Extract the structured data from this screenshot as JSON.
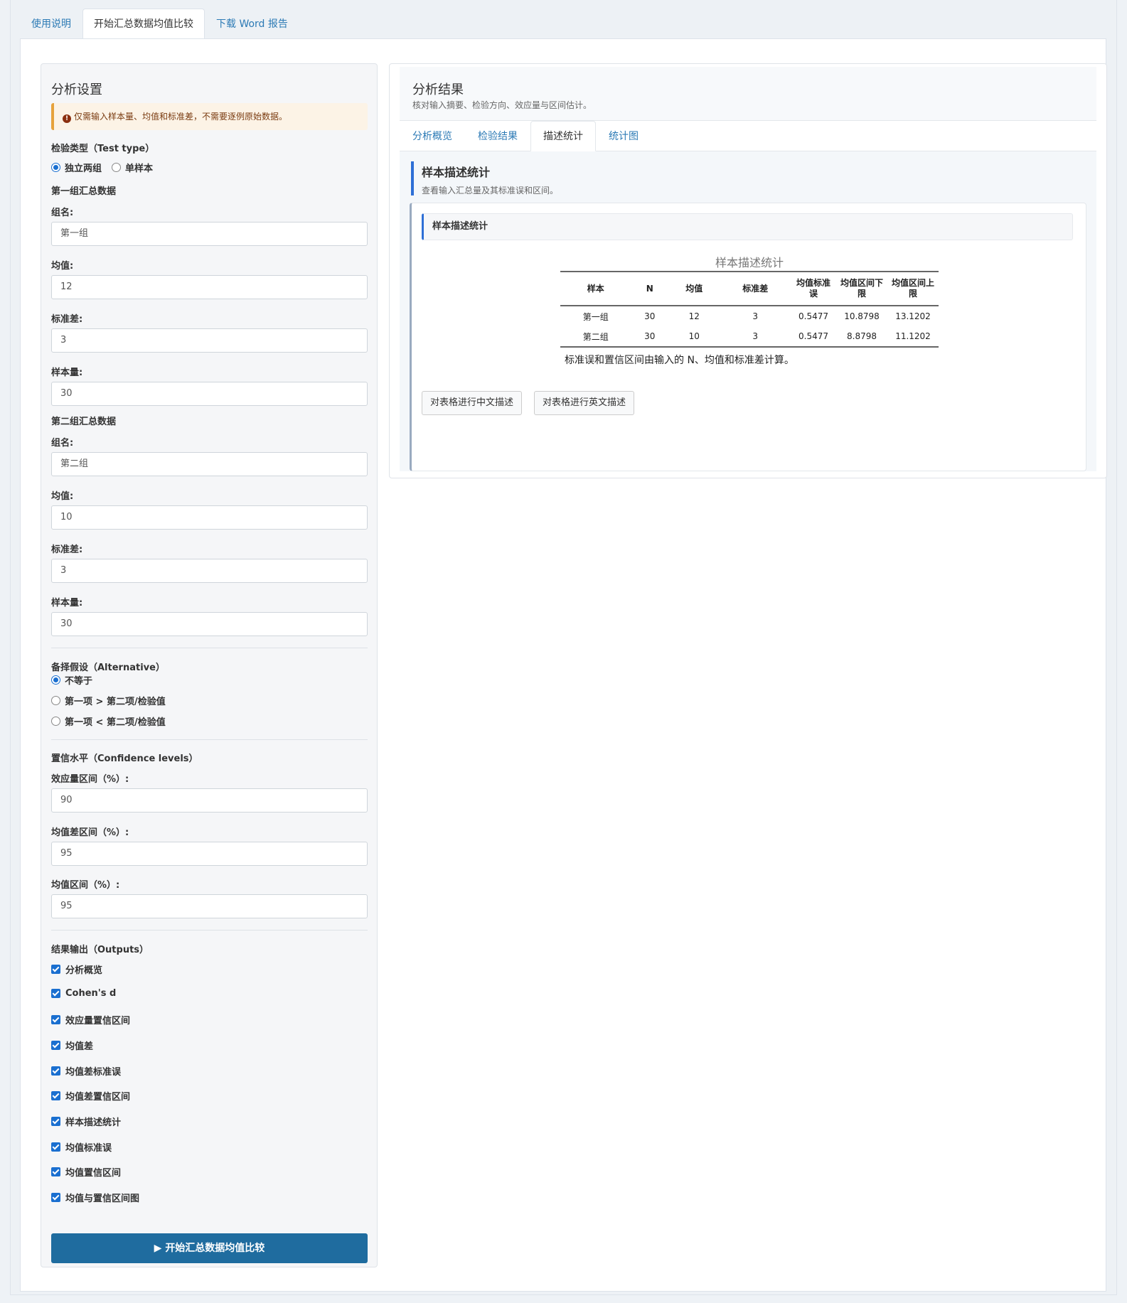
{
  "top_tabs": [
    "使用说明",
    "开始汇总数据均值比较",
    "下载 Word 报告"
  ],
  "settings": {
    "title": "分析设置",
    "warning": "仅需输入样本量、均值和标准差，不需要逐例原始数据。",
    "warning_icon": "exclamation-circle-icon",
    "test_type_label": "检验类型（Test type）",
    "test_type_options": [
      "独立两组",
      "单样本"
    ],
    "group1": {
      "header": "第一组汇总数据",
      "name_label": "组名:",
      "name": "第一组",
      "mean_label": "均值:",
      "mean": "12",
      "sd_label": "标准差:",
      "sd": "3",
      "n_label": "样本量:",
      "n": "30"
    },
    "group2": {
      "header": "第二组汇总数据",
      "name_label": "组名:",
      "name": "第二组",
      "mean_label": "均值:",
      "mean": "10",
      "sd_label": "标准差:",
      "sd": "3",
      "n_label": "样本量:",
      "n": "30"
    },
    "alternative_label": "备择假设（Alternative）",
    "alternative_options": [
      "不等于",
      "第一项 > 第二项/检验值",
      "第一项 < 第二项/检验值"
    ],
    "confidence_label": "置信水平（Confidence levels）",
    "es_ci_label": "效应量区间（%）:",
    "es_ci": "90",
    "md_ci_label": "均值差区间（%）:",
    "md_ci": "95",
    "mean_ci_label": "均值区间（%）:",
    "mean_ci": "95",
    "outputs_label": "结果输出（Outputs）",
    "outputs": [
      "分析概览",
      "Cohen's d",
      "效应量置信区间",
      "均值差",
      "均值差标准误",
      "均值差置信区间",
      "样本描述统计",
      "均值标准误",
      "均值置信区间",
      "均值与置信区间图"
    ],
    "run_button": "▶ 开始汇总数据均值比较"
  },
  "results": {
    "title": "分析结果",
    "subtitle": "核对输入摘要、检验方向、效应量与区间估计。",
    "tabs": [
      "分析概览",
      "检验结果",
      "描述统计",
      "统计图"
    ],
    "section_title": "样本描述统计",
    "section_sub": "查看输入汇总量及其标准误和区间。",
    "card_title": "样本描述统计",
    "table": {
      "caption": "样本描述统计",
      "headers": [
        "样本",
        "N",
        "均值",
        "标准差",
        "均值标准误",
        "均值区间下限",
        "均值区间上限"
      ],
      "rows": [
        [
          "第一组",
          "30",
          "12",
          "3",
          "0.5477",
          "10.8798",
          "13.1202"
        ],
        [
          "第二组",
          "30",
          "10",
          "3",
          "0.5477",
          "8.8798",
          "11.1202"
        ]
      ],
      "note": "标准误和置信区间由输入的 N、均值和标准差计算。"
    },
    "buttons": [
      "对表格进行中文描述",
      "对表格进行英文描述"
    ]
  }
}
